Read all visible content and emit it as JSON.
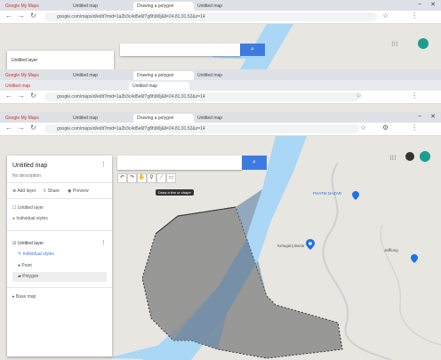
{
  "windows": [
    {
      "tabs": [
        "Google My Maps",
        "Untitled map",
        "Drawing a polygon",
        "Untitled map"
      ],
      "url": "google.com/maps/d/edit?mid=1a2b3c4d5e6f7g8h9i0j&ll=24.81,91.52&z=14",
      "search_placeholder": "",
      "layer_label": "Untitled layer"
    },
    {
      "tabs": [
        "Google My Maps",
        "Untitled map",
        "Drawing a polygon",
        "Untitled map",
        "Untitled map",
        "Untitled map"
      ],
      "url": "google.com/maps/d/edit?mid=1a2b3c4d5e6f7g8h9i0j&ll=24.81,91.52&z=14"
    },
    {
      "tabs": [
        "Google My Maps",
        "Untitled map",
        "Drawing a polygon",
        "Untitled map"
      ],
      "url": "google.com/maps/d/edit?mid=1a2b3c4d5e6f7g8h9i0j&ll=24.81,91.52&z=14"
    }
  ],
  "panel": {
    "title": "Untitled map",
    "subtitle": "No description",
    "actions": [
      "Add layer",
      "Share",
      "Preview"
    ],
    "base_items": [
      "Untitled layer",
      "Individual styles"
    ],
    "layer_title": "Untitled layer",
    "layer_sub": "Individual styles",
    "features": [
      "Point",
      "Polygon"
    ],
    "base_map": "Base map"
  },
  "search": {
    "placeholder": "",
    "button_icon": "search-icon"
  },
  "tools": [
    "undo-icon",
    "redo-icon",
    "hand-icon",
    "marker-icon",
    "line-icon",
    "ruler-icon"
  ],
  "tooltip": "Draw a line or shape",
  "map_labels": [
    "PHATIK BAZAR",
    "Ketuganj Bazar",
    "Jafflong"
  ],
  "colors": {
    "water": "#a9d7f5",
    "polygon": "#888888",
    "accent": "#3d7be0",
    "marker": "#1a73e8"
  }
}
